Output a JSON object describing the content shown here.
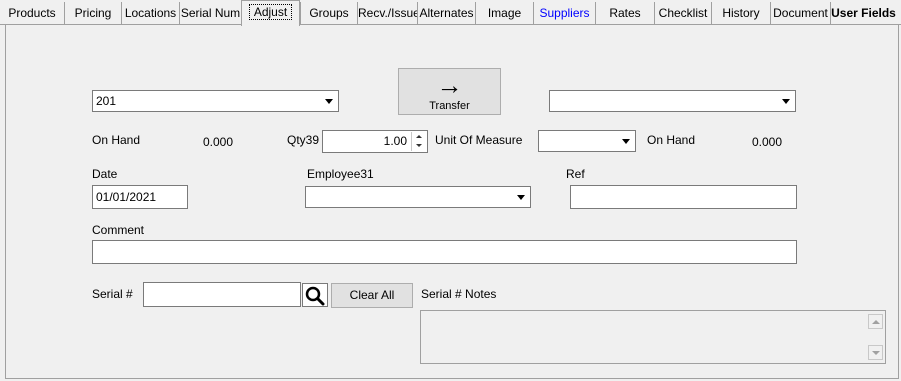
{
  "tabs": [
    {
      "label": "Products"
    },
    {
      "label": "Pricing"
    },
    {
      "label": "Locations"
    },
    {
      "label": "Serial Num"
    },
    {
      "label": "Adjust"
    },
    {
      "label": "Groups"
    },
    {
      "label": "Recv./Issue"
    },
    {
      "label": "Alternates"
    },
    {
      "label": "Image"
    },
    {
      "label": "Suppliers"
    },
    {
      "label": "Rates"
    },
    {
      "label": "Checklist"
    },
    {
      "label": "History"
    },
    {
      "label": "Document"
    },
    {
      "label": "User Fields"
    }
  ],
  "transfer": {
    "from_location": "201",
    "to_location": "",
    "button_label": "Transfer",
    "arrow_glyph": "→"
  },
  "on_hand_left": {
    "label": "On Hand",
    "value": "0.000"
  },
  "qty": {
    "label": "Qty39",
    "value": "1.00"
  },
  "uom": {
    "label": "Unit Of Measure",
    "value": ""
  },
  "on_hand_right": {
    "label": "On Hand",
    "value": "0.000"
  },
  "date": {
    "label": "Date",
    "value": "01/01/2021"
  },
  "employee": {
    "label": "Employee31",
    "value": ""
  },
  "ref": {
    "label": "Ref",
    "value": ""
  },
  "comment": {
    "label": "Comment",
    "value": ""
  },
  "serial": {
    "label": "Serial #",
    "value": "",
    "clear_label": "Clear All"
  },
  "serial_notes": {
    "label": "Serial # Notes",
    "value": ""
  },
  "colors": {
    "link_tab": "#0000ff",
    "background": "#f0f0f0",
    "border": "#a0a0a0"
  }
}
